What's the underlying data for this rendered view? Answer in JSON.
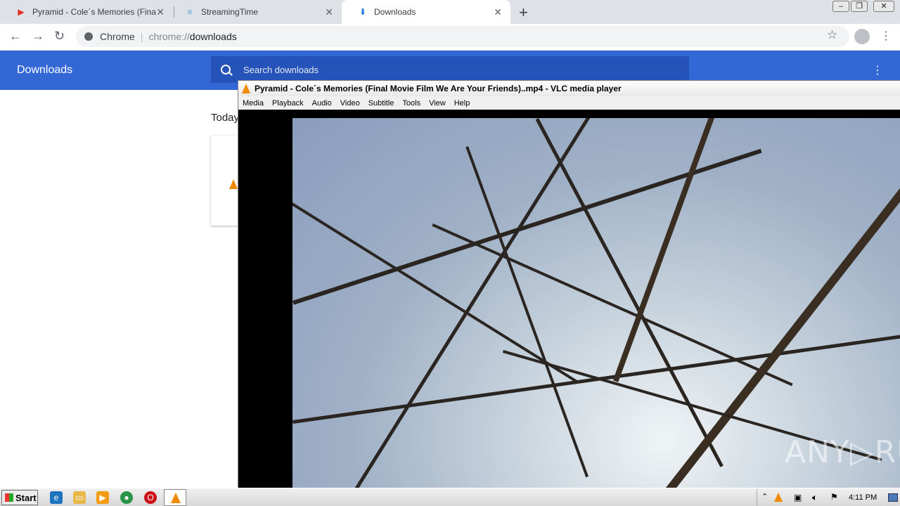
{
  "browser": {
    "tabs": [
      {
        "title": "Pyramid - Cole´s Memories (Final Mo",
        "icon": "youtube-icon"
      },
      {
        "title": "StreamingTime",
        "icon": "streamingtime-icon"
      },
      {
        "title": "Downloads",
        "icon": "download-icon"
      }
    ],
    "close_glyph": "✕",
    "new_tab_glyph": "+",
    "omnibox_site": "Chrome",
    "omnibox_scheme": "chrome://",
    "omnibox_path": "downloads"
  },
  "downloads": {
    "title": "Downloads",
    "search_placeholder": "Search downloads",
    "section_today": "Today"
  },
  "vlc": {
    "title": "Pyramid - Cole´s Memories (Final Movie Film We Are Your Friends)..mp4 - VLC media player",
    "menu": [
      "Media",
      "Playback",
      "Audio",
      "Video",
      "Subtitle",
      "Tools",
      "View",
      "Help"
    ],
    "watermark": "ANY▷RUN"
  },
  "taskbar": {
    "start_label": "Start",
    "clock": "4:11 PM"
  }
}
